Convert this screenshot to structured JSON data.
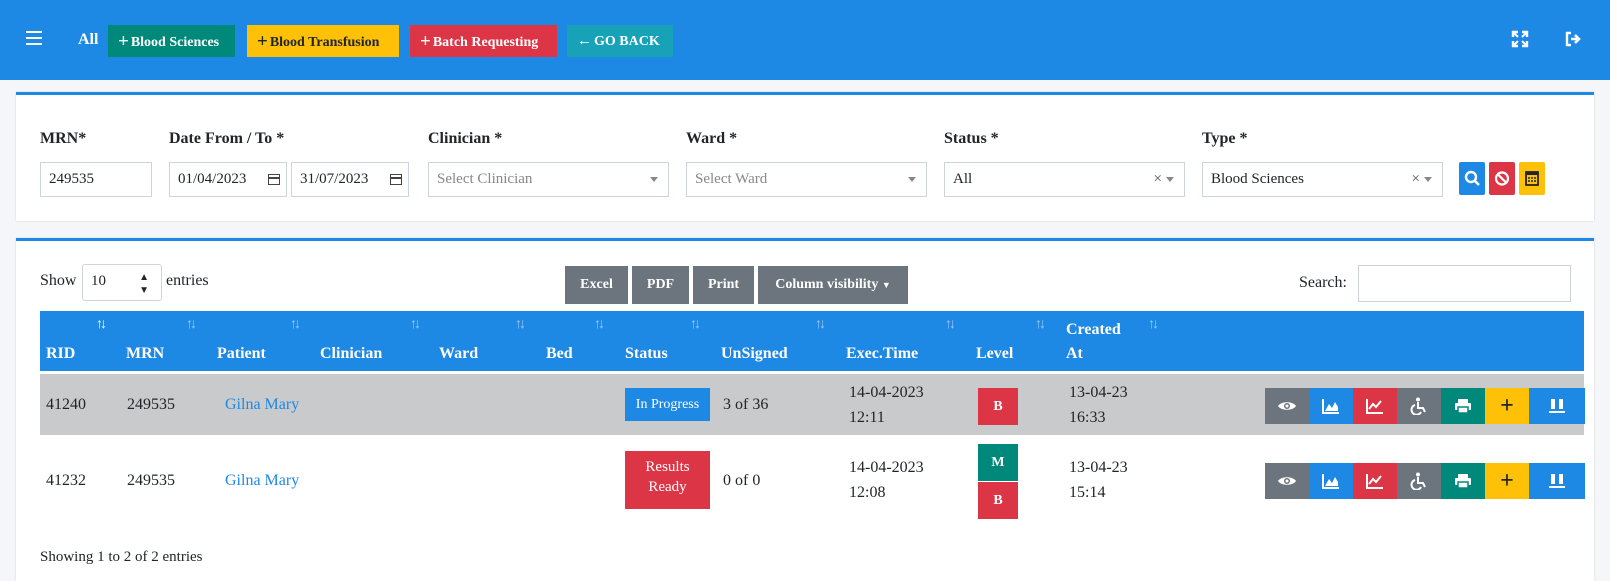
{
  "topbar": {
    "all_label": "All",
    "buttons": [
      {
        "label": "Blood Sciences",
        "color": "#00897b"
      },
      {
        "label": "Blood Transfusion",
        "color": "#ffc107"
      },
      {
        "label": "Batch Requesting",
        "color": "#dc3545"
      },
      {
        "label": "GO BACK",
        "color": "#17a2b8"
      }
    ]
  },
  "filters": {
    "mrn": {
      "label": "MRN*",
      "value": "249535"
    },
    "date": {
      "label": "Date From / To *",
      "from": "01/04/2023",
      "to": "31/07/2023"
    },
    "clinician": {
      "label": "Clinician *",
      "placeholder": "Select Clinician"
    },
    "ward": {
      "label": "Ward *",
      "placeholder": "Select Ward"
    },
    "status": {
      "label": "Status *",
      "value": "All",
      "clear": "×"
    },
    "type": {
      "label": "Type *",
      "value": "Blood Sciences",
      "clear": "×"
    }
  },
  "table_controls": {
    "show_label": "Show",
    "entries_value": "10",
    "entries_label": "entries",
    "buttons": [
      "Excel",
      "PDF",
      "Print",
      "Column visibility"
    ],
    "search_label": "Search:"
  },
  "table": {
    "columns": [
      "RID",
      "MRN",
      "Patient",
      "Clinician",
      "Ward",
      "Bed",
      "Status",
      "UnSigned",
      "Exec.Time",
      "Level",
      "Created",
      "At"
    ],
    "rows": [
      {
        "rid": "41240",
        "mrn": "249535",
        "patient": "Gilna Mary",
        "status": "In Progress",
        "unsigned": "3 of 36",
        "exec_date": "14-04-2023",
        "exec_time": "12:11",
        "levels": [
          "B"
        ],
        "created_date": "13-04-23",
        "created_time": "16:33"
      },
      {
        "rid": "41232",
        "mrn": "249535",
        "patient": "Gilna Mary",
        "status_line1": "Results",
        "status_line2": "Ready",
        "unsigned": "0 of 0",
        "exec_date": "14-04-2023",
        "exec_time": "12:08",
        "levels": [
          "M",
          "B"
        ],
        "created_date": "13-04-23",
        "created_time": "15:14"
      }
    ],
    "footer": "Showing 1 to 2 of 2 entries"
  },
  "colors": {
    "primary": "#1e88e5",
    "teal": "#00897b",
    "yellow": "#ffc107",
    "red": "#dc3545",
    "cyan": "#17a2b8",
    "gray": "#6c757d"
  }
}
